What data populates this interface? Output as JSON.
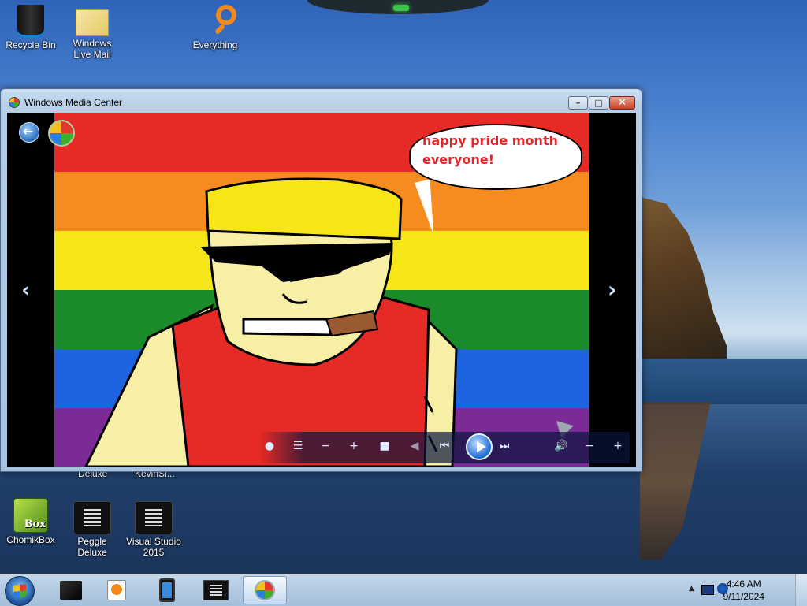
{
  "desktop": {
    "icons_top": [
      {
        "label": "Recycle Bin",
        "icon": "recycle-bin-icon"
      },
      {
        "label": "Windows Live Mail",
        "icon": "mail-icon"
      },
      {
        "label": "Everything",
        "icon": "search-magnifier-icon"
      }
    ],
    "icons_bottom": [
      {
        "label": "ChomikBox",
        "icon": "chomikbox-icon",
        "badge": "Box"
      },
      {
        "label": "Peggle Deluxe",
        "icon": "app-icon"
      },
      {
        "label": "Visual Studio 2015",
        "icon": "app-icon"
      }
    ],
    "partial_labels": [
      "Deluxe",
      "KevinSi..."
    ]
  },
  "window": {
    "title": "Windows Media Center",
    "buttons": {
      "minimize": "–",
      "maximize": "□",
      "close": "✕"
    },
    "nav": {
      "prev": "‹",
      "next": "›"
    },
    "speech_bubble": "happy pride month everyone!",
    "controls": {
      "record": "●",
      "guide": "☰",
      "channel_down": "−",
      "channel_up": "+",
      "stop": "■",
      "rewind": "◀",
      "skip_back": "⏮",
      "skip_forward": "⏭",
      "mute": "🔊",
      "volume_down": "−",
      "volume_up": "+"
    },
    "flag_colors": [
      "#e62a25",
      "#f68b1f",
      "#f7e617",
      "#1a8a2a",
      "#1e63e0",
      "#7b2a96"
    ]
  },
  "taskbar": {
    "clock_time": "4:46 AM",
    "clock_date": "9/11/2024"
  }
}
